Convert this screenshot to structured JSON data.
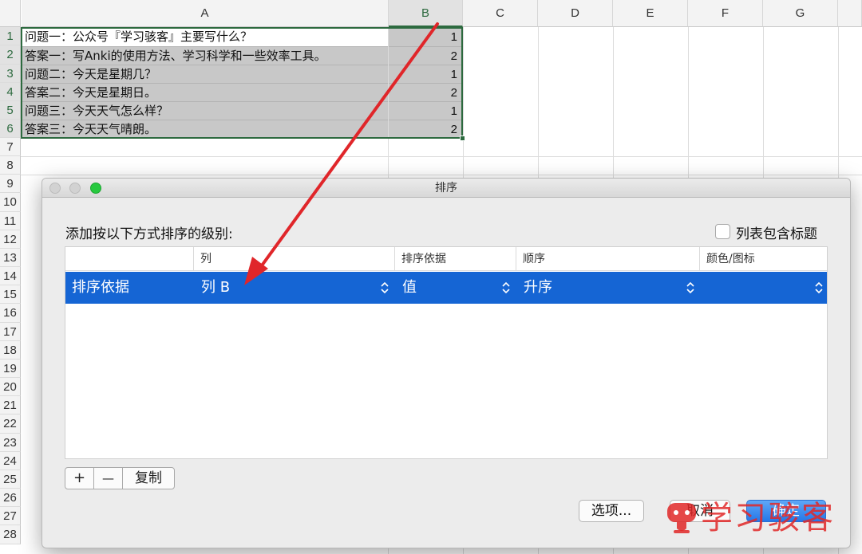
{
  "sheet": {
    "columns": [
      "A",
      "B",
      "C",
      "D",
      "E",
      "F",
      "G"
    ],
    "rows": [
      "1",
      "2",
      "3",
      "4",
      "5",
      "6",
      "7",
      "8",
      "9",
      "10",
      "11",
      "12",
      "13",
      "14",
      "15",
      "16",
      "17",
      "18",
      "19",
      "20",
      "21",
      "22",
      "23",
      "24",
      "25",
      "26",
      "27",
      "28"
    ],
    "cells": [
      {
        "a": "问题一：公众号『学习骇客』主要写什么？",
        "b": "1"
      },
      {
        "a": "答案一：写Anki的使用方法、学习科学和一些效率工具。",
        "b": "2"
      },
      {
        "a": "问题二：今天是星期几？",
        "b": "1"
      },
      {
        "a": "答案二：今天是星期日。",
        "b": "2"
      },
      {
        "a": "问题三：今天天气怎么样？",
        "b": "1"
      },
      {
        "a": "答案三：今天天气晴朗。",
        "b": "2"
      }
    ]
  },
  "dialog": {
    "title": "排序",
    "heading": "添加按以下方式排序的级别:",
    "header_checkbox_label": "列表包含标题",
    "header_checkbox_checked": false,
    "table_headers": [
      "",
      "列",
      "排序依据",
      "顺序",
      "颜色/图标"
    ],
    "row": {
      "label": "排序依据",
      "column": "列 B",
      "sort_on": "值",
      "order": "升序",
      "color": ""
    },
    "add_label": "+",
    "remove_label": "—",
    "copy_label": "复制",
    "options_label": "选项...",
    "cancel_label": "取消",
    "ok_label": "确定"
  },
  "watermark": {
    "text": "学习骇客"
  },
  "colors": {
    "selection_green": "#2d6a3f",
    "row_highlight": "#1565d4",
    "arrow_red": "#e0262a",
    "watermark_red": "#e12828"
  },
  "icons": {
    "stepper": "up-down-chevron-icon",
    "watermark_logo": "watermark-logo-icon",
    "arrow": "annotation-arrow"
  }
}
